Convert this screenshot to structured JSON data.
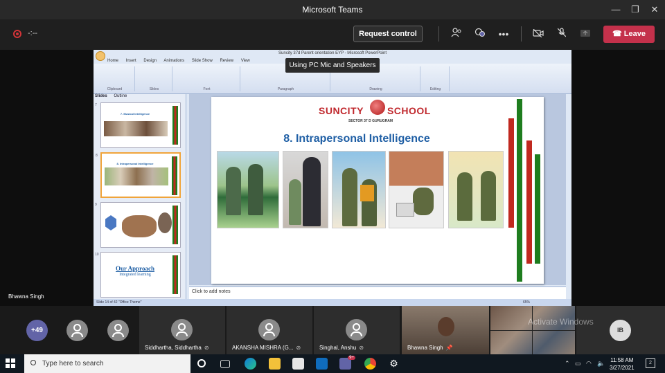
{
  "window": {
    "title": "Microsoft Teams",
    "minimize": "—",
    "restore": "❐",
    "close": "✕"
  },
  "toolbar": {
    "timer": "-:--",
    "request_control": "Request control",
    "leave": "Leave",
    "leave_icon": "phone-hangup-icon"
  },
  "tooltip": {
    "text": "Using PC Mic and Speakers"
  },
  "ppt": {
    "title": "Suncity 37d Parent orientation EYP - Microsoft PowerPoint",
    "tabs": [
      "Home",
      "Insert",
      "Design",
      "Animations",
      "Slide Show",
      "Review",
      "View"
    ],
    "ribbon_groups": [
      "Clipboard",
      "Slides",
      "Font",
      "Paragraph",
      "Drawing",
      "Editing"
    ],
    "pane_tabs": [
      "Slides",
      "Outline"
    ],
    "thumbs": [
      {
        "num": "7",
        "caption": "7. Musical Intelligence"
      },
      {
        "num": "8",
        "caption": "8. Intrapersonal Intelligence"
      },
      {
        "num": "9",
        "caption": ""
      },
      {
        "num": "10",
        "caption": "Our Approach",
        "sub": "Integrated learning"
      }
    ],
    "notes": "Click to add notes",
    "status": "Slide 14 of 42   \"Office Theme\"",
    "zoom": "65%"
  },
  "slide": {
    "logo_left": "SUNCITY",
    "logo_right": "SCHOOL",
    "logo_sub": "SECTOR 37 D GURUGRAM",
    "heading": "8. Intrapersonal Intelligence",
    "bar_colors": [
      "#1e7d1e",
      "#c0281f",
      "#1e7d1e"
    ]
  },
  "presenter": {
    "name": "Bhawna Singh"
  },
  "participants": {
    "overflow": "+49",
    "tiles": [
      {
        "name": "Siddhartha, Siddhartha"
      },
      {
        "name": "AKANSHA MISHRA (G..."
      },
      {
        "name": "Singhal, Anshu"
      },
      {
        "name": "Bhawna Singh"
      }
    ],
    "initials": "IB",
    "watermark": "Activate Windows"
  },
  "taskbar": {
    "search_placeholder": "Type here to search",
    "time": "11:58 AM",
    "date": "3/27/2021",
    "teams_badge": "9+",
    "notification_count": "2"
  },
  "colors": {
    "leave": "#c4314b",
    "accent": "#6264a7",
    "slide_heading": "#1f5fa5",
    "logo_red": "#c0282d"
  }
}
